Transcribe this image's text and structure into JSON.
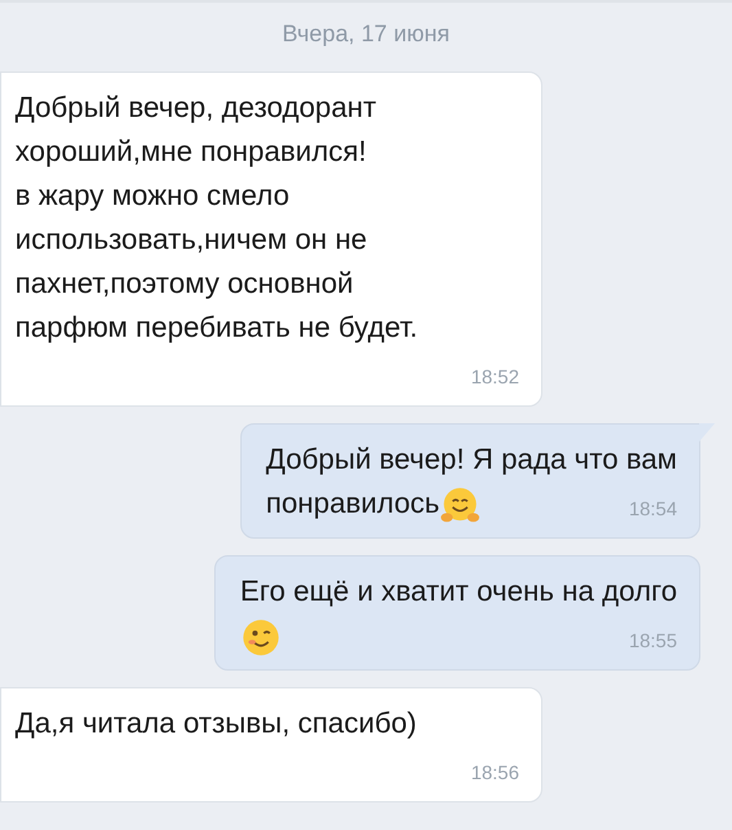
{
  "date_divider": "Вчера, 17 июня",
  "messages": [
    {
      "kind": "incoming",
      "lines": [
        "Добрый вечер, дезодорант",
        "хороший,мне понравился!",
        "в жару можно смело",
        "использовать,ничем он не",
        "пахнет,поэтому основной",
        "парфюм перебивать не будет."
      ],
      "time": "18:52"
    },
    {
      "kind": "outgoing",
      "tail": true,
      "lines": [
        "Добрый вечер! Я рада что вам",
        "понравилось"
      ],
      "emoji": {
        "kind": "hug"
      },
      "time": "18:54"
    },
    {
      "kind": "outgoing",
      "lines": [
        "Его ещё и хватит очень на долго"
      ],
      "emoji": {
        "kind": "wink",
        "newline": true
      },
      "time": "18:55"
    },
    {
      "kind": "incoming",
      "lines": [
        "Да,я читала отзывы, спасибо)"
      ],
      "time": "18:56"
    }
  ]
}
